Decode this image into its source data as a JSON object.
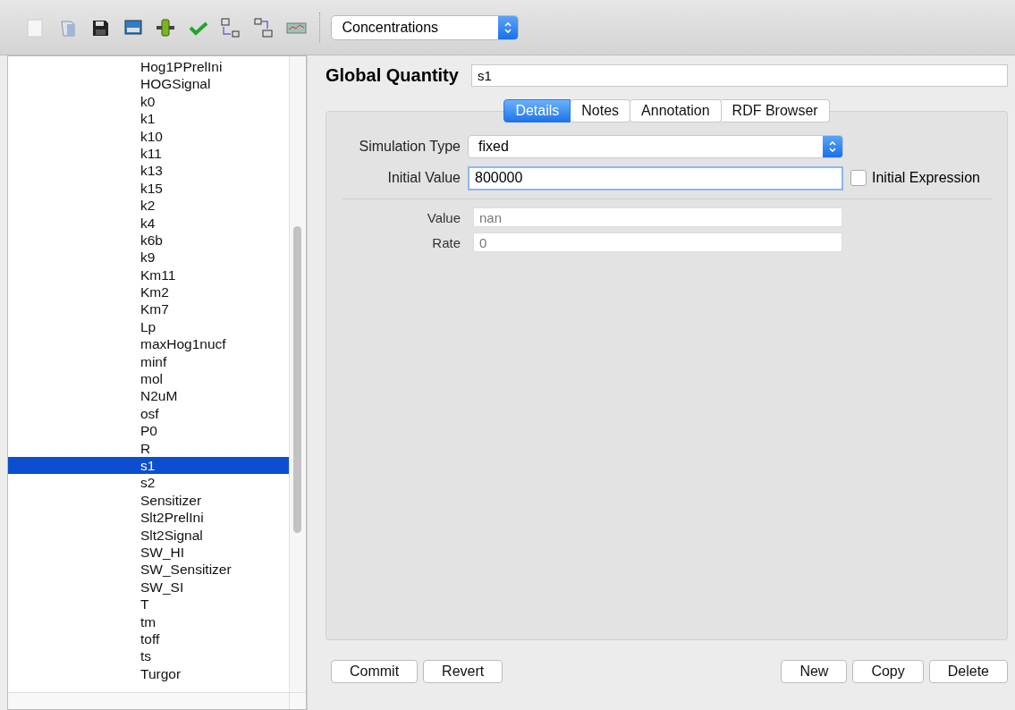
{
  "toolbar": {
    "view_select": {
      "value": "Concentrations"
    }
  },
  "list": {
    "items": [
      {
        "label": "Hog1PPrelIni",
        "selected": false
      },
      {
        "label": "HOGSignal",
        "selected": false
      },
      {
        "label": "k0",
        "selected": false
      },
      {
        "label": "k1",
        "selected": false
      },
      {
        "label": "k10",
        "selected": false
      },
      {
        "label": "k11",
        "selected": false
      },
      {
        "label": "k13",
        "selected": false
      },
      {
        "label": "k15",
        "selected": false
      },
      {
        "label": "k2",
        "selected": false
      },
      {
        "label": "k4",
        "selected": false
      },
      {
        "label": "k6b",
        "selected": false
      },
      {
        "label": "k9",
        "selected": false
      },
      {
        "label": "Km11",
        "selected": false
      },
      {
        "label": "Km2",
        "selected": false
      },
      {
        "label": "Km7",
        "selected": false
      },
      {
        "label": "Lp",
        "selected": false
      },
      {
        "label": "maxHog1nucf",
        "selected": false
      },
      {
        "label": "minf",
        "selected": false
      },
      {
        "label": "mol",
        "selected": false
      },
      {
        "label": "N2uM",
        "selected": false
      },
      {
        "label": "osf",
        "selected": false
      },
      {
        "label": "P0",
        "selected": false
      },
      {
        "label": "R",
        "selected": false
      },
      {
        "label": "s1",
        "selected": true
      },
      {
        "label": "s2",
        "selected": false
      },
      {
        "label": "Sensitizer",
        "selected": false
      },
      {
        "label": "Slt2PrelIni",
        "selected": false
      },
      {
        "label": "Slt2Signal",
        "selected": false
      },
      {
        "label": "SW_HI",
        "selected": false
      },
      {
        "label": "SW_Sensitizer",
        "selected": false
      },
      {
        "label": "SW_SI",
        "selected": false
      },
      {
        "label": "T",
        "selected": false
      },
      {
        "label": "tm",
        "selected": false
      },
      {
        "label": "toff",
        "selected": false
      },
      {
        "label": "ts",
        "selected": false
      },
      {
        "label": "Turgor",
        "selected": false
      }
    ]
  },
  "editor": {
    "heading": "Global Quantity",
    "name": "s1",
    "tabs": [
      {
        "label": "Details",
        "selected": true
      },
      {
        "label": "Notes",
        "selected": false
      },
      {
        "label": "Annotation",
        "selected": false
      },
      {
        "label": "RDF Browser",
        "selected": false
      }
    ],
    "simulation_type": {
      "label": "Simulation Type",
      "value": "fixed"
    },
    "initial_value": {
      "label": "Initial Value",
      "value": "800000"
    },
    "initial_expression": {
      "label": "Initial Expression",
      "checked": false
    },
    "value": {
      "label": "Value",
      "value": "nan"
    },
    "rate": {
      "label": "Rate",
      "value": "0"
    },
    "buttons_left": [
      "Commit",
      "Revert"
    ],
    "buttons_right": [
      "New",
      "Copy",
      "Delete"
    ]
  }
}
